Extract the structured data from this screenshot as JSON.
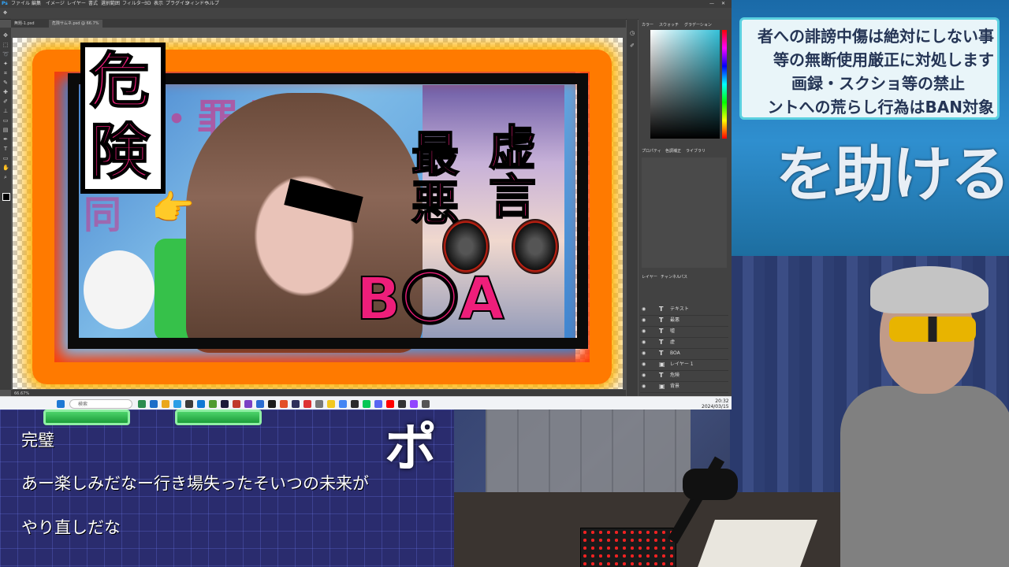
{
  "rules_panel": {
    "lines": [
      "者への誹謗中傷は絶対にしない事",
      "等の無断使用厳正に対処します",
      "画録・スクショ等の禁止",
      "ントへの荒らし行為はBAN対象"
    ],
    "headline": "を助ける"
  },
  "chat": {
    "messages": [
      "完璧",
      "あー楽しみだなー行き場失ったそいつの未来が",
      "やり直しだな"
    ],
    "ticker_char": "ポ"
  },
  "photoshop": {
    "menu": [
      "ファイル",
      "編集",
      "イメージ",
      "レイヤー",
      "書式",
      "選択範囲",
      "フィルター",
      "3D",
      "表示",
      "プラグイン",
      "ウィンドウ",
      "ヘルプ"
    ],
    "tabs": [
      "無題-1.psd",
      "危険サムネ.psd @ 66.7%"
    ],
    "status": "66.67%",
    "panels": {
      "color_tabs": [
        "カラー",
        "スウォッチ",
        "グラデーション"
      ],
      "props_tabs": [
        "プロパティ",
        "色調補正",
        "ライブラリ"
      ],
      "layers_tabs": [
        "レイヤー",
        "チャンネル",
        "パス"
      ],
      "layers": [
        {
          "name": "テキスト"
        },
        {
          "name": "最悪"
        },
        {
          "name": "嘘"
        },
        {
          "name": "虚"
        },
        {
          "name": "BOA"
        },
        {
          "name": "レイヤー 1"
        },
        {
          "name": "危険"
        },
        {
          "name": "背景"
        }
      ]
    },
    "taskbar": {
      "search_placeholder": "検索",
      "time": "20:32",
      "date": "2024/03/15"
    }
  },
  "thumbnail": {
    "danger": [
      "危",
      "険"
    ],
    "right_col": "虚言",
    "left_col": "最悪",
    "boa": "B〇A",
    "bg_text": "疑・罪な事",
    "bg_text2": "同"
  },
  "colors": {
    "accent_pink": "#ee1e7a",
    "fire": "#ff7a00"
  }
}
